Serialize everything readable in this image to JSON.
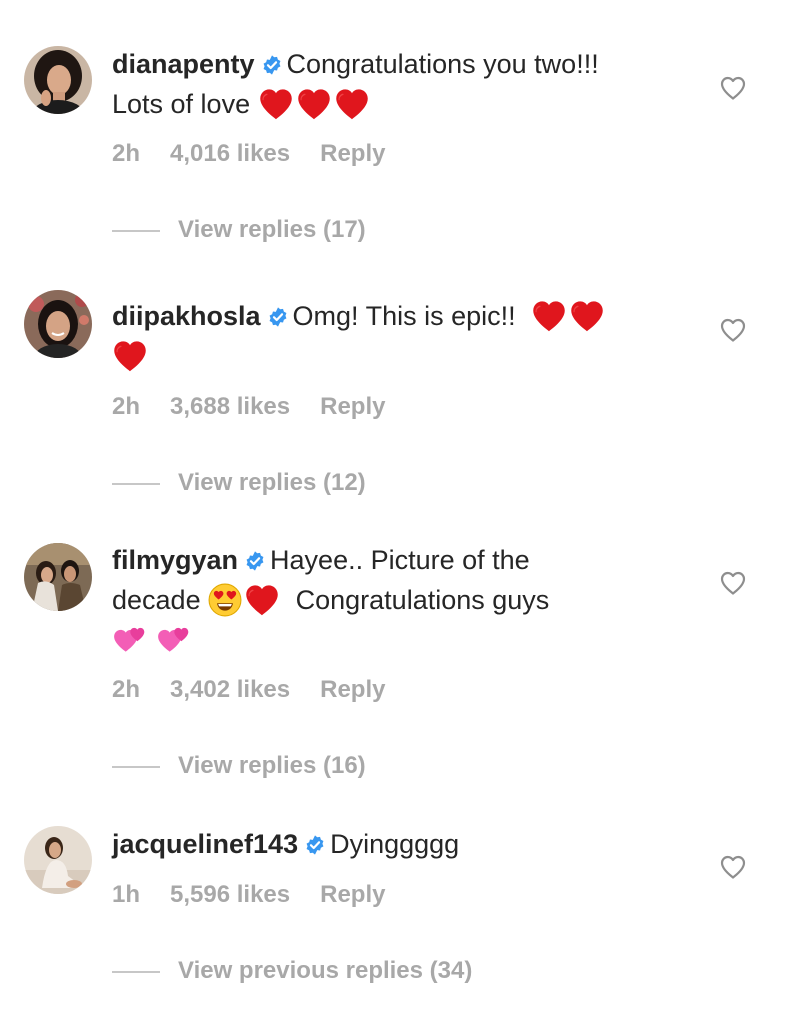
{
  "comments": [
    {
      "username": "dianapenty",
      "text_line1": "Congratulations you two!!!",
      "text_line2": "Lots of love",
      "time": "2h",
      "likes": "4,016 likes",
      "reply": "Reply",
      "replies": "View replies (17)"
    },
    {
      "username": "diipakhosla",
      "text_line1": "Omg! This is epic!!",
      "time": "2h",
      "likes": "3,688 likes",
      "reply": "Reply",
      "replies": "View replies (12)"
    },
    {
      "username": "filmygyan",
      "text_line1": "Hayee.. Picture of the",
      "text_line2a": "decade",
      "text_line2b": "Congratulations guys",
      "time": "2h",
      "likes": "3,402 likes",
      "reply": "Reply",
      "replies": "View replies (16)"
    },
    {
      "username": "jacquelinef143",
      "text_line1": "Dyinggggg",
      "time": "1h",
      "likes": "5,596 likes",
      "reply": "Reply",
      "replies": "View previous replies (34)"
    }
  ],
  "icons": {
    "verified": "verified-badge-icon",
    "like": "heart-outline-icon",
    "heart_emoji": "red-heart-emoji",
    "face_emoji": "heart-eyes-emoji",
    "sparkle_heart": "two-hearts-emoji"
  },
  "colors": {
    "text": "#262626",
    "secondary": "#a8a8a8",
    "verified": "#3897f0",
    "heart": "#e0161d"
  }
}
